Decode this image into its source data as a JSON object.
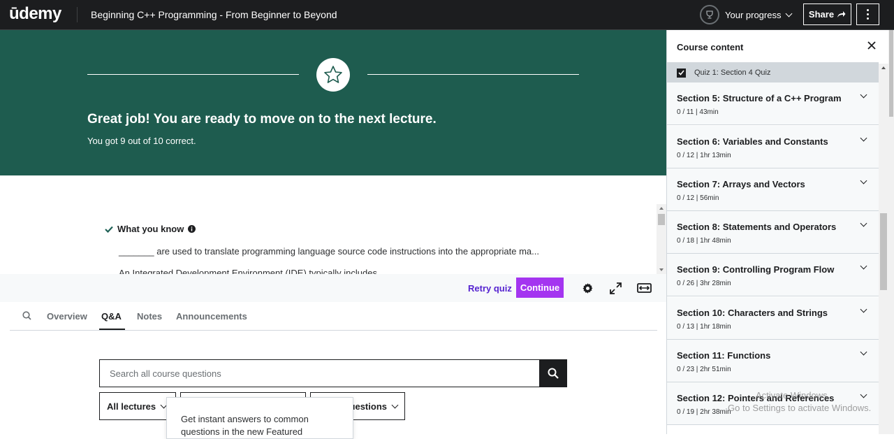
{
  "header": {
    "logo_text": "ūdemy",
    "course_title": "Beginning C++ Programming - From Beginner to Beyond",
    "progress_label": "Your progress",
    "share_label": "Share"
  },
  "hero": {
    "title": "Great job! You are ready to move on to the next lecture.",
    "subtitle": "You got 9 out of 10 correct.",
    "bg_color": "#1e5c4f"
  },
  "quiz": {
    "what_you_know": "What you know",
    "questions": [
      "_______ are used to translate programming language source code instructions into the appropriate ma...",
      "An Integrated Development Environment (IDE) typically includes"
    ]
  },
  "controls": {
    "retry_label": "Retry quiz",
    "continue_label": "Continue",
    "accent_color": "#a435f0"
  },
  "tabs": {
    "items": [
      "Overview",
      "Q&A",
      "Notes",
      "Announcements"
    ],
    "active": "Q&A"
  },
  "qa": {
    "search_placeholder": "Search all course questions",
    "filters": [
      "All lectures",
      "",
      "uestions"
    ],
    "popover_text": "Get instant answers to common questions in the new Featured"
  },
  "sidebar": {
    "title": "Course content",
    "current_item": "Quiz 1: Section 4 Quiz",
    "sections": [
      {
        "title": "Section 5: Structure of a C++ Program",
        "meta": "0 / 11 | 43min"
      },
      {
        "title": "Section 6: Variables and Constants",
        "meta": "0 / 12 | 1hr 13min"
      },
      {
        "title": "Section 7: Arrays and Vectors",
        "meta": "0 / 12 | 56min"
      },
      {
        "title": "Section 8: Statements and Operators",
        "meta": "0 / 18 | 1hr 48min"
      },
      {
        "title": "Section 9: Controlling Program Flow",
        "meta": "0 / 26 | 3hr 28min"
      },
      {
        "title": "Section 10: Characters and Strings",
        "meta": "0 / 13 | 1hr 18min"
      },
      {
        "title": "Section 11: Functions",
        "meta": "0 / 23 | 2hr 51min"
      },
      {
        "title": "Section 12: Pointers and References",
        "meta": "0 / 19 | 2hr 38min"
      }
    ]
  },
  "watermark": {
    "line1": "Activate Windows",
    "line2": "Go to Settings to activate Windows."
  }
}
